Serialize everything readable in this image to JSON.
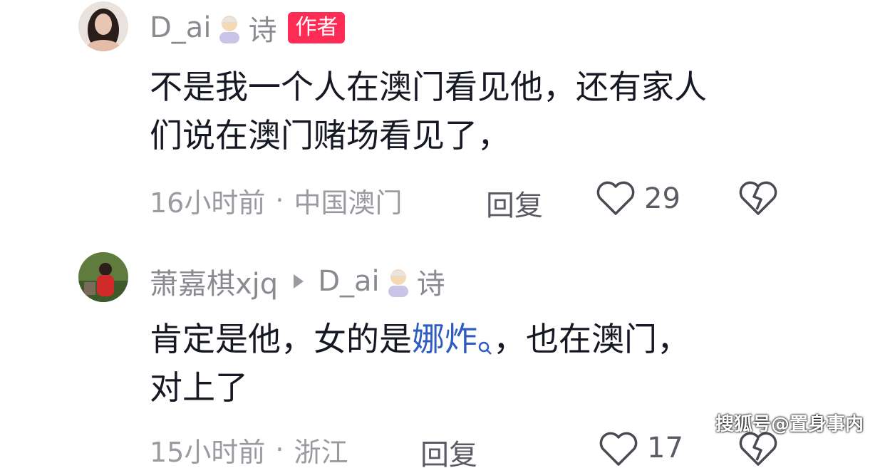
{
  "comments": [
    {
      "username": "D_ai",
      "username_suffix": "诗",
      "badge": "作者",
      "text_line1": "不是我一个人在澳门看见他，还有家人",
      "text_line2": "们说在澳门赌场看见了，",
      "time": "16小时前",
      "location": "中国澳门",
      "reply_label": "回复",
      "likes": "29"
    },
    {
      "username": "萧嘉棋xjq",
      "reply_to": "D_ai",
      "reply_to_suffix": "诗",
      "text_part1": "肯定是他，女的是",
      "text_link": "娜炸",
      "text_part2": "，也在澳门，",
      "text_line2": "对上了",
      "time": "15小时前",
      "location": "浙江",
      "reply_label": "回复",
      "likes": "17"
    }
  ],
  "watermark": "搜狐号@置身事内",
  "colors": {
    "badge": "#fe2c55",
    "link": "#2f5cc2",
    "meta": "#9a9ba1"
  }
}
